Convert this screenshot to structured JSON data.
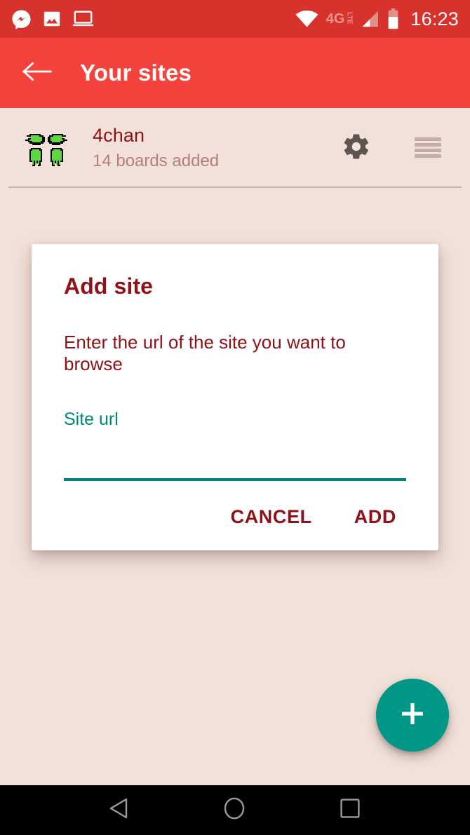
{
  "status_bar": {
    "background_color": "#d8322c",
    "clock": "16:23",
    "network_label": "4G",
    "network_sublabel": "LTE",
    "left_icons": [
      {
        "name": "messenger-icon",
        "label": "Messenger notification"
      },
      {
        "name": "image-icon",
        "label": "Screenshot captured"
      },
      {
        "name": "laptop-icon",
        "label": "Connected device"
      }
    ],
    "right_icons": [
      {
        "name": "wifi-icon",
        "label": "Wi-Fi"
      },
      {
        "name": "cellular-signal-icon",
        "label": "Cellular signal"
      },
      {
        "name": "battery-icon",
        "label": "Battery"
      }
    ]
  },
  "app_bar": {
    "background_color": "#f4433c",
    "title": "Your sites",
    "back_icon": "arrow-left-icon"
  },
  "site_list": {
    "items": [
      {
        "name": "4chan",
        "subtitle": "14 boards added",
        "favicon": "four-leaf-clover-icon",
        "settings_icon": "gear-icon",
        "drag_icon": "drag-handle-icon"
      }
    ]
  },
  "dialog": {
    "title": "Add site",
    "message": "Enter the url of the site you want to browse",
    "field": {
      "label": "Site url",
      "value": "",
      "placeholder": "",
      "accent_color": "#00897b"
    },
    "buttons": [
      {
        "name": "cancel-button",
        "label": "CANCEL"
      },
      {
        "name": "add-button",
        "label": "ADD"
      }
    ],
    "text_color": "#8e1218"
  },
  "fab": {
    "icon": "plus-icon",
    "color": "#009688",
    "label": "Add site"
  },
  "nav_bar": {
    "buttons": [
      {
        "name": "nav-back-button",
        "icon": "triangle-back-icon"
      },
      {
        "name": "nav-home-button",
        "icon": "circle-home-icon"
      },
      {
        "name": "nav-recents-button",
        "icon": "square-recents-icon"
      }
    ]
  },
  "theme": {
    "background": "#f1e1d9",
    "primary": "#f4433c",
    "primary_dark": "#d8322c",
    "accent": "#009688",
    "text_primary": "#8e1218",
    "text_secondary": "#b57e7c"
  }
}
